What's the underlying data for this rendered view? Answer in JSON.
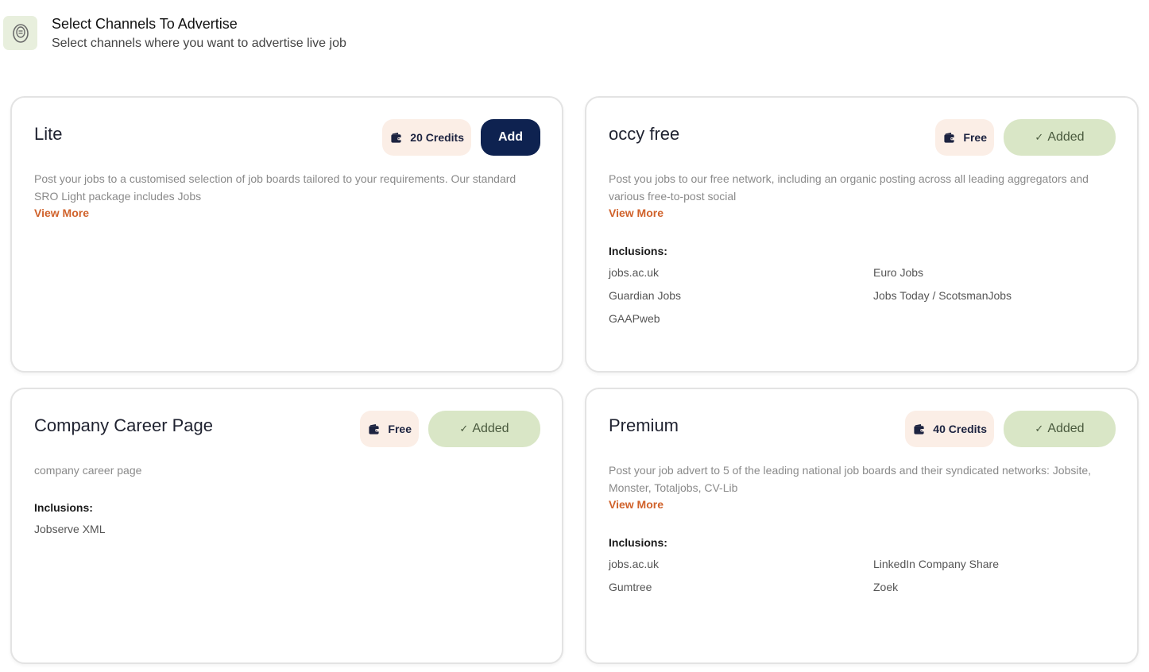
{
  "header": {
    "title": "Select Channels To Advertise",
    "subtitle": "Select channels where you want to advertise live job",
    "icon": "coin-icon"
  },
  "colors": {
    "accent_dark": "#0e2250",
    "added_bg": "#d9e6c6",
    "chip_bg": "#fbeee6",
    "link": "#d0622b"
  },
  "cards": [
    {
      "title": "Lite",
      "credits": "20 Credits",
      "action": "Add",
      "description": "Post your jobs to a customised selection of job boards tailored to your requirements. Our standard SRO Light package includes Jobs",
      "view_more": "View More"
    },
    {
      "title": "occy free",
      "credits": "Free",
      "action": "Added",
      "description": "Post you jobs to our free network, including an organic posting across all leading aggregators and various free-to-post social",
      "view_more": "View More",
      "inclusions_title": "Inclusions:",
      "inclusions": [
        "jobs.ac.uk",
        "Euro Jobs",
        "Guardian Jobs",
        "Jobs Today / ScotsmanJobs",
        "GAAPweb"
      ]
    },
    {
      "title": "Company Career Page",
      "credits": "Free",
      "action": "Added",
      "description": "company career page",
      "inclusions_title": "Inclusions:",
      "inclusions": [
        "Jobserve XML"
      ]
    },
    {
      "title": "Premium",
      "credits": "40 Credits",
      "action": "Added",
      "description": "Post your job advert to 5 of the leading national job boards and their syndicated networks: Jobsite, Monster, Totaljobs, CV-Lib",
      "view_more": "View More",
      "inclusions_title": "Inclusions:",
      "inclusions": [
        "jobs.ac.uk",
        "LinkedIn Company Share",
        "Gumtree",
        "Zoek"
      ]
    }
  ]
}
